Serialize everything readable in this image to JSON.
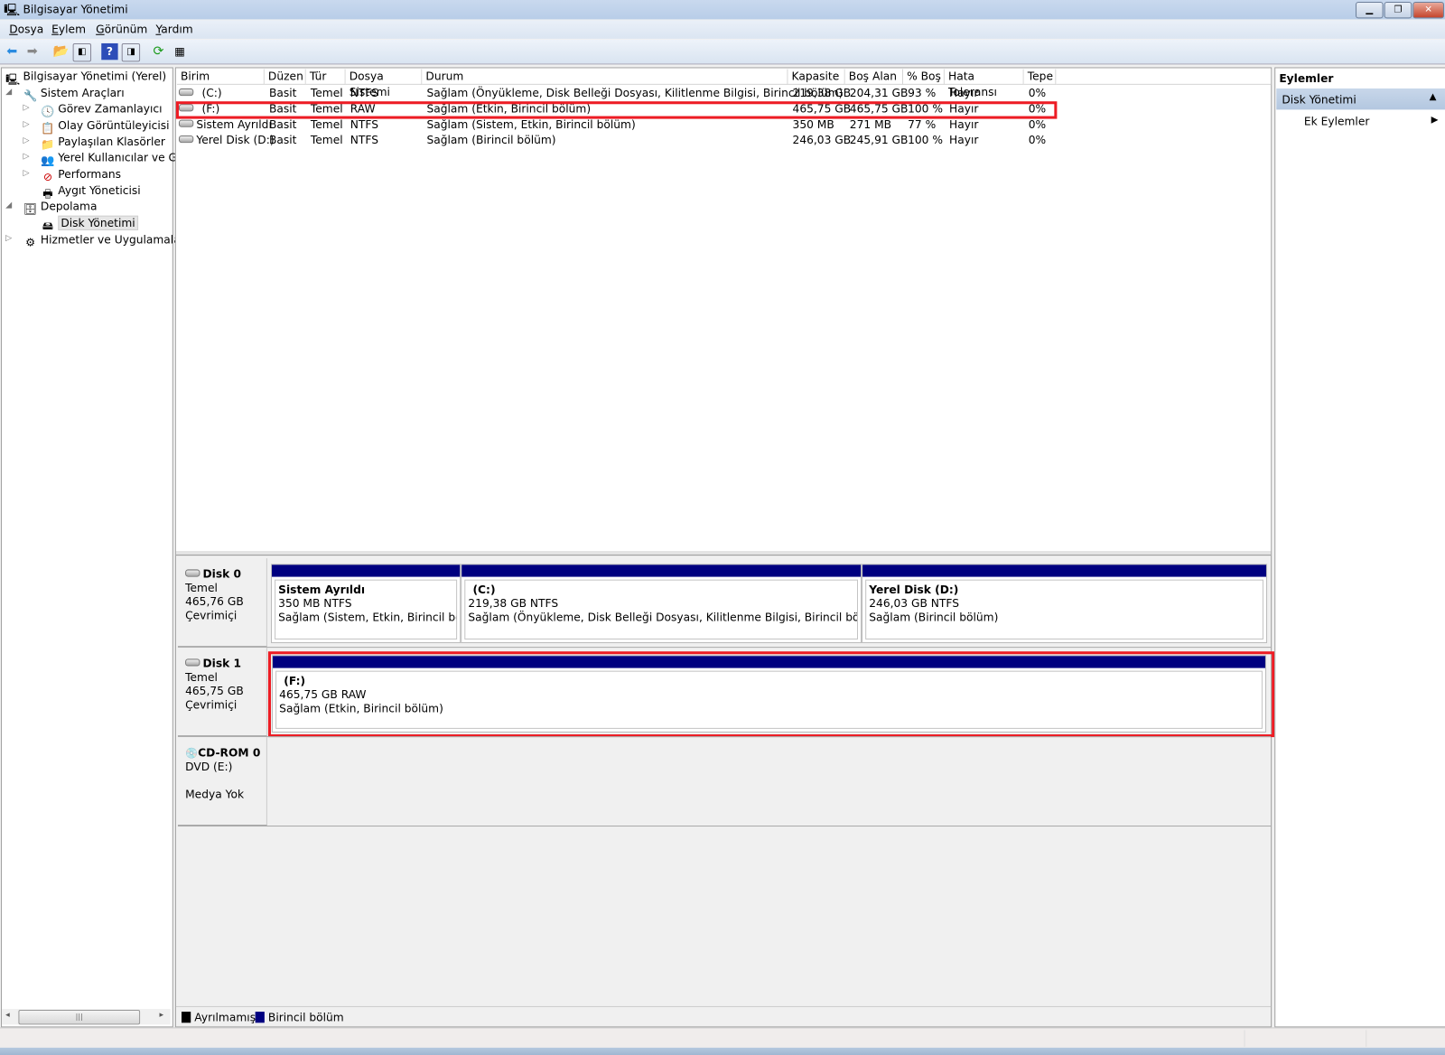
{
  "window": {
    "title": "Bilgisayar Yönetimi",
    "controls": [
      "minimize",
      "restore",
      "close"
    ]
  },
  "menu": [
    {
      "label": "Dosya",
      "accel": "D",
      "rest": "osya"
    },
    {
      "label": "Eylem",
      "accel": "E",
      "rest": "ylem"
    },
    {
      "label": "Görünüm",
      "accel": "G",
      "rest": "örünüm"
    },
    {
      "label": "Yardım",
      "accel": "Y",
      "rest": "ardım"
    }
  ],
  "toolbar": [
    "back-icon",
    "forward-icon",
    "up-folder-icon",
    "show-hide-tree-icon",
    "help-icon",
    "show-hide-action-pane-icon",
    "refresh-icon",
    "properties-icon"
  ],
  "tree": {
    "root": "Bilgisayar Yönetimi (Yerel)",
    "system_tools": "Sistem Araçları",
    "task_scheduler": "Görev Zamanlayıcı",
    "event_viewer": "Olay Görüntüleyicisi",
    "shared_folders": "Paylaşılan Klasörler",
    "local_users": "Yerel Kullanıcılar ve Gru",
    "performance": "Performans",
    "device_manager": "Aygıt Yöneticisi",
    "storage": "Depolama",
    "disk_management": "Disk Yönetimi",
    "services": "Hizmetler ve Uygulamalar"
  },
  "volumes": {
    "columns": [
      "Birim",
      "Düzen",
      "Tür",
      "Dosya Sistemi",
      "Durum",
      "Kapasite",
      "Boş Alan",
      "% Boş",
      "Hata Toleransı",
      "Tepe"
    ],
    "rows": [
      [
        "(C:)",
        "Basit",
        "Temel",
        "NTFS",
        "Sağlam (Önyükleme, Disk Belleği Dosyası, Kilitlenme Bilgisi, Birincil bölüm)",
        "219,38 GB",
        "204,31 GB",
        "93 %",
        "Hayır",
        "0%"
      ],
      [
        "(F:)",
        "Basit",
        "Temel",
        "RAW",
        "Sağlam (Etkin, Birincil bölüm)",
        "465,75 GB",
        "465,75 GB",
        "100 %",
        "Hayır",
        "0%"
      ],
      [
        "Sistem Ayrıldı",
        "Basit",
        "Temel",
        "NTFS",
        "Sağlam (Sistem, Etkin, Birincil bölüm)",
        "350 MB",
        "271 MB",
        "77 %",
        "Hayır",
        "0%"
      ],
      [
        "Yerel Disk (D:)",
        "Basit",
        "Temel",
        "NTFS",
        "Sağlam (Birincil bölüm)",
        "246,03 GB",
        "245,91 GB",
        "100 %",
        "Hayır",
        "0%"
      ]
    ]
  },
  "disks": [
    {
      "name": "Disk 0",
      "type": "Temel",
      "size": "465,76 GB",
      "status": "Çevrimiçi",
      "partitions": [
        {
          "name": "Sistem Ayrıldı",
          "size": "350 MB NTFS",
          "status": "Sağlam (Sistem, Etkin, Birincil bölüm)"
        },
        {
          "name": "(C:)",
          "size": "219,38 GB NTFS",
          "status": "Sağlam (Önyükleme, Disk Belleği Dosyası, Kilitlenme Bilgisi, Birincil bölüm)"
        },
        {
          "name": "Yerel Disk  (D:)",
          "size": "246,03 GB NTFS",
          "status": "Sağlam (Birincil bölüm)"
        }
      ]
    },
    {
      "name": "Disk 1",
      "type": "Temel",
      "size": "465,75 GB",
      "status": "Çevrimiçi",
      "partitions": [
        {
          "name": "(F:)",
          "size": "465,75 GB RAW",
          "status": "Sağlam (Etkin, Birincil bölüm)"
        }
      ]
    },
    {
      "name": "CD-ROM 0",
      "type": "DVD (E:)",
      "status": "Medya Yok"
    }
  ],
  "legend": [
    {
      "label": "Ayrılmamış",
      "color": "#000000"
    },
    {
      "label": "Birincil bölüm",
      "color": "#000080"
    }
  ],
  "actions": {
    "header": "Eylemler",
    "section": "Disk Yönetimi",
    "more": "Ek Eylemler"
  },
  "colors": {
    "highlight": "#ed1c24",
    "primary_partition": "#000080"
  }
}
